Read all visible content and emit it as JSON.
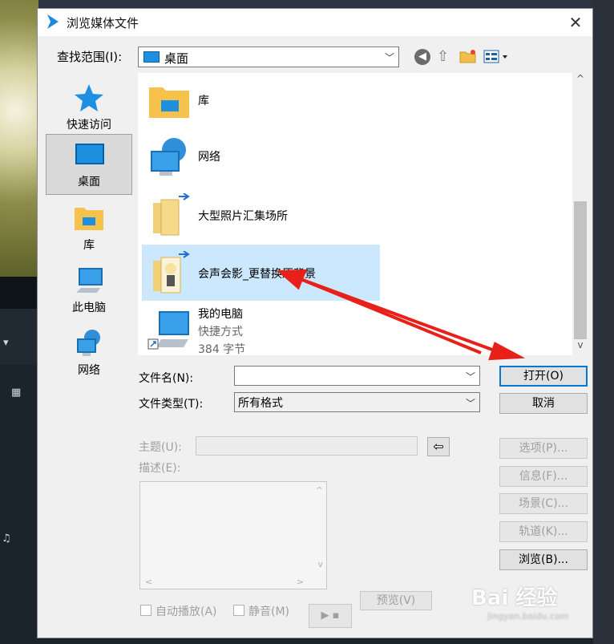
{
  "dialog": {
    "title": "浏览媒体文件",
    "close_glyph": "✕"
  },
  "lookin": {
    "label": "查找范围(I):",
    "value": "桌面"
  },
  "toolbar": {
    "back_glyph": "◀",
    "up_glyph": "⇧"
  },
  "places": [
    {
      "label": "快速访问",
      "icon": "star-icon"
    },
    {
      "label": "桌面",
      "icon": "desktop-icon",
      "active": true
    },
    {
      "label": "库",
      "icon": "library-folder-icon"
    },
    {
      "label": "此电脑",
      "icon": "computer-icon"
    },
    {
      "label": "网络",
      "icon": "network-icon"
    }
  ],
  "files": [
    {
      "name": "库",
      "icon": "library-folder-icon"
    },
    {
      "name": "网络",
      "icon": "network-icon"
    },
    {
      "name": "大型照片汇集场所",
      "icon": "shared-folder-icon"
    },
    {
      "name": "会声会影_更替换原背景",
      "icon": "shared-folder-icon",
      "selected": true
    },
    {
      "name": "我的电脑",
      "sub1": "快捷方式",
      "sub2": "384 字节",
      "icon": "shortcut-computer-icon"
    }
  ],
  "scroll": {
    "up_glyph": "^",
    "down_glyph": "v"
  },
  "form": {
    "filename_label": "文件名(N):",
    "filename_value": "",
    "filetype_label": "文件类型(T):",
    "filetype_value": "所有格式",
    "subject_label": "主题(U):",
    "description_label": "描述(E):",
    "autoplay_label": "自动播放(A)",
    "mute_label": "静音(M)",
    "preview_label": "预览(V)"
  },
  "buttons": {
    "open": "打开(O)",
    "cancel": "取消",
    "options": "选项(P)...",
    "info": "信息(F)...",
    "scene": "场景(C)...",
    "track": "轨道(K)...",
    "browse": "浏览(B)..."
  },
  "watermark": {
    "text": "Bai 经验",
    "sub": "jingyan.baidu.com"
  },
  "colors": {
    "accent": "#0078d7",
    "selection": "#cce8ff",
    "annotation_arrow": "#e8201a"
  }
}
